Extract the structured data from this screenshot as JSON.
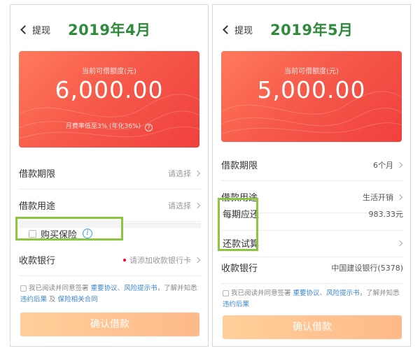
{
  "left": {
    "back_label": "提现",
    "month": "2019年4月",
    "card": {
      "caption": "当前可借额度(元)",
      "amount": "6,000.00",
      "rate": "月费率低至3% (年化36%)",
      "help_glyph": "?"
    },
    "rows": {
      "term_label": "借款期限",
      "term_value": "请选择",
      "purpose_label": "借款用途",
      "purpose_value": "请选择",
      "insurance_label": "购买保险",
      "info_glyph": "i",
      "bank_label": "收款银行",
      "bank_value": "请添加收款银行卡"
    },
    "agreement": {
      "prefix": "我已阅读并同意签署",
      "link1": "重要协议",
      "sep": "、",
      "link2": "风险提示书",
      "middle": "，了解并知悉",
      "link3": "违约后果",
      "and": "及",
      "link4": "保险相关合同"
    },
    "confirm_label": "确认借款"
  },
  "right": {
    "back_label": "提现",
    "month": "2019年5月",
    "card": {
      "caption": "当前可借额度(元)",
      "amount": "5,000.00"
    },
    "rows": {
      "term_label": "借款期限",
      "term_value": "6个月",
      "purpose_label": "借款用途",
      "purpose_value": "生活开销",
      "installment_label": "每期应还",
      "installment_value": "983.33元",
      "trial_label": "还款试算",
      "bank_label": "收款银行",
      "bank_value": "中国建设银行(5378)"
    },
    "agreement": {
      "prefix": "我已阅读并同意签署",
      "link1": "重要协议",
      "sep": "、",
      "link2": "风险提示书",
      "middle": "，了解并知悉",
      "link3": "违约后果"
    },
    "confirm_label": "确认借款"
  },
  "colors": {
    "card_red": "#f0403e",
    "highlight_green": "#8cc63f",
    "month_green": "#2e8b3c",
    "link_blue": "#3a86d4",
    "confirm_orange": "#ffb98a"
  }
}
